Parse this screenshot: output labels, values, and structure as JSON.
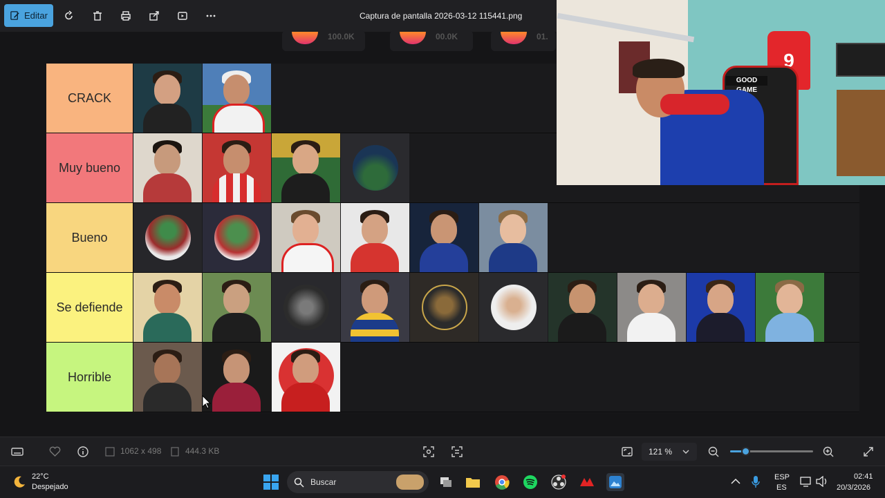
{
  "toolbar": {
    "edit_label": "Editar",
    "file_title": "Captura de pantalla 2026-03-12 115441.png",
    "icons": [
      "edit-icon",
      "rotate-icon",
      "delete-icon",
      "print-icon",
      "share-icon",
      "slideshow-icon",
      "more-icon"
    ]
  },
  "partial_stats": [
    "100.0K",
    "00.0K",
    "01."
  ],
  "tiers": [
    {
      "label": "CRACK",
      "color": "#f9b47f",
      "count": 2
    },
    {
      "label": "Muy bueno",
      "color": "#f2787b",
      "count": 4
    },
    {
      "label": "Bueno",
      "color": "#f8d67f",
      "count": 6
    },
    {
      "label": "Se defiende",
      "color": "#fbf27f",
      "count": 10
    },
    {
      "label": "Horrible",
      "color": "#c6f57f",
      "count": 3
    }
  ],
  "webcam": {
    "jersey_number": "9",
    "chair_text": "GOOD GAME"
  },
  "statusbar": {
    "dimensions": "1062 x 498",
    "file_size": "444.3 KB",
    "zoom": "121 %",
    "zoom_slider_fraction": 0.18
  },
  "taskbar": {
    "weather_temp": "22°C",
    "weather_desc": "Despejado",
    "search_placeholder": "Buscar",
    "lang_top": "ESP",
    "lang_bottom": "ES",
    "time": "02:41",
    "date": "20/3/2026"
  },
  "colors": {
    "accent": "#4aa3df",
    "background": "#151517",
    "toolbar": "#202023"
  }
}
